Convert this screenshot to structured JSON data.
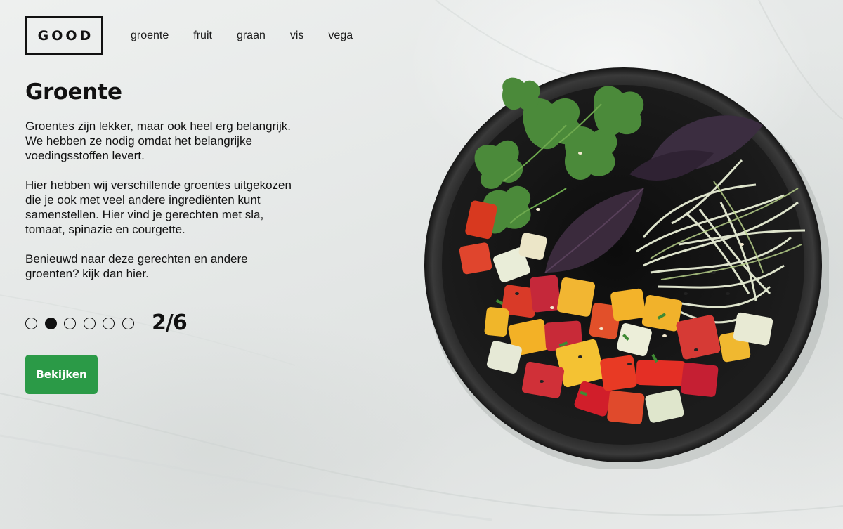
{
  "brand": {
    "logo": "GOOD"
  },
  "nav": {
    "items": [
      "groente",
      "fruit",
      "graan",
      "vis",
      "vega"
    ]
  },
  "hero": {
    "title": "Groente",
    "paragraphs": [
      "Groentes zijn lekker, maar ook heel erg belangrijk. We hebben ze nodig omdat het belangrijke voedingsstoffen levert.",
      "Hier hebben wij verschillende groentes uitgekozen die je ook met veel andere ingrediënten kunt samenstellen. Hier vind je gerechten met sla, tomaat, spinazie en courgette.",
      "Benieuwd naar deze gerechten en andere groenten? kijk dan hier."
    ],
    "paragraph_lines": [
      [
        "Groentes zijn lekker, maar ook heel erg belangrijk.",
        "We hebben ze nodig omdat het belangrijke",
        "voedingsstoffen levert."
      ],
      [
        "Hier hebben wij verschillende groentes uitgekozen",
        "die je ook met veel andere ingrediënten kunt",
        "samenstellen. Hier vind je gerechten met sla,",
        "tomaat, spinazie en courgette."
      ],
      [
        "Benieuwd naar deze gerechten en andere",
        "groenten? kijk dan hier."
      ]
    ]
  },
  "carousel": {
    "current": 2,
    "total": 6,
    "counter": "2/6"
  },
  "cta": {
    "label": "Bekijken",
    "color": "#2b9a47"
  },
  "image": {
    "subject": "black bowl with salad: cilantro, purple basil, cucumber, tomato, bell pepper, sesame, sprouts",
    "bowl_color": "#1b1b1b"
  }
}
